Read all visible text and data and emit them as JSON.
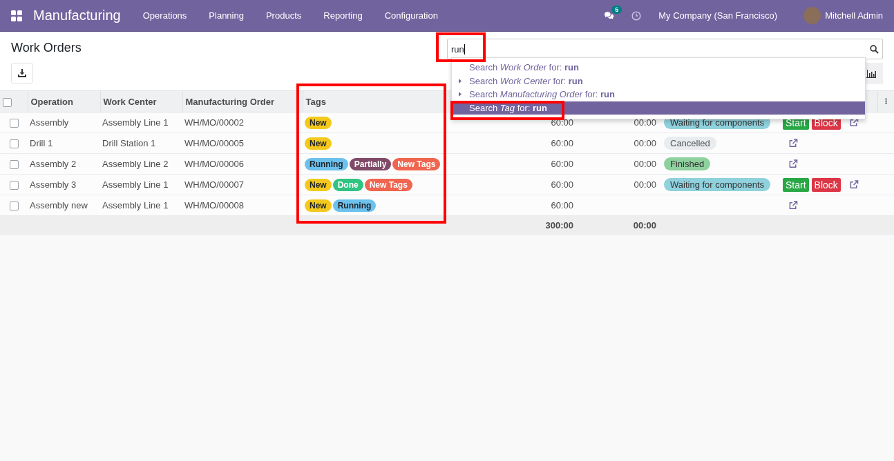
{
  "navbar": {
    "app_name": "Manufacturing",
    "menus": [
      "Operations",
      "Planning",
      "Products",
      "Reporting",
      "Configuration"
    ],
    "messages_count": "5",
    "company": "My Company (San Francisco)",
    "user": "Mitchell Admin"
  },
  "page_title": "Work Orders",
  "search": {
    "value": "run",
    "suggestions": [
      {
        "label": "Search *Work Order* for: **run**",
        "expandable": false,
        "selected": false
      },
      {
        "label": "Search *Work Center* for: **run**",
        "expandable": true,
        "selected": false
      },
      {
        "label": "Search *Manufacturing Order* for: **run**",
        "expandable": true,
        "selected": false
      },
      {
        "label": "Search *Tag* for: **run**",
        "expandable": false,
        "selected": true
      }
    ]
  },
  "table": {
    "header_checked": false,
    "columns": [
      "Operation",
      "Work Center",
      "Manufacturing Order",
      "Tags"
    ],
    "rows": [
      {
        "checked": false,
        "operation": "Assembly",
        "work_center": "Assembly Line 1",
        "manufacturing_order": "WH/MO/00002",
        "tags": [
          {
            "label": "New",
            "color": "#f4c91b"
          }
        ],
        "expected_duration": "60:00",
        "real_duration": "00:00",
        "status": {
          "label": "Waiting for components",
          "kind": "waiting"
        },
        "actions": [
          "Start",
          "Block"
        ]
      },
      {
        "checked": false,
        "operation": "Drill 1",
        "work_center": "Drill Station 1",
        "manufacturing_order": "WH/MO/00005",
        "tags": [
          {
            "label": "New",
            "color": "#f4c91b"
          }
        ],
        "expected_duration": "60:00",
        "real_duration": "00:00",
        "status": {
          "label": "Cancelled",
          "kind": "cancelled"
        },
        "actions": []
      },
      {
        "checked": false,
        "operation": "Assembly 2",
        "work_center": "Assembly Line 2",
        "manufacturing_order": "WH/MO/00006",
        "tags": [
          {
            "label": "Running",
            "color": "#6cc1ed"
          },
          {
            "label": "Partially",
            "color": "#814968"
          },
          {
            "label": "New Tags",
            "color": "#f0654f"
          }
        ],
        "expected_duration": "60:00",
        "real_duration": "00:00",
        "status": {
          "label": "Finished",
          "kind": "finished"
        },
        "actions": []
      },
      {
        "checked": false,
        "operation": "Assembly 3",
        "work_center": "Assembly Line 1",
        "manufacturing_order": "WH/MO/00007",
        "tags": [
          {
            "label": "New",
            "color": "#f4c91b"
          },
          {
            "label": "Done",
            "color": "#30c381"
          },
          {
            "label": "New Tags",
            "color": "#f0654f"
          }
        ],
        "expected_duration": "60:00",
        "real_duration": "00:00",
        "status": {
          "label": "Waiting for components",
          "kind": "waiting"
        },
        "actions": [
          "Start",
          "Block"
        ]
      },
      {
        "checked": false,
        "operation": "Assembly new",
        "work_center": "Assembly Line 1",
        "manufacturing_order": "WH/MO/00008",
        "tags": [
          {
            "label": "New",
            "color": "#f4c91b"
          },
          {
            "label": "Running",
            "color": "#6cc1ed"
          }
        ],
        "expected_duration": "60:00",
        "actions": []
      }
    ],
    "totals": {
      "expected_duration": "300:00",
      "real_duration": "00:00"
    }
  }
}
